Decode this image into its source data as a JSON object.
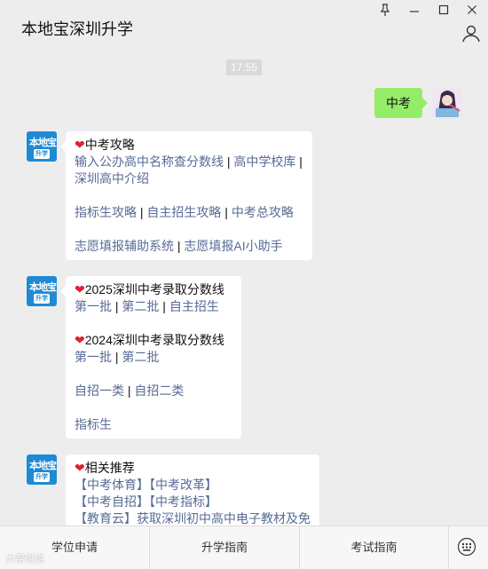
{
  "window": {
    "title": "本地宝深圳升学",
    "pin_icon": "pin-icon",
    "minimize_icon": "minimize-icon",
    "maximize_icon": "maximize-icon",
    "close_icon": "close-icon",
    "profile_icon": "person-icon"
  },
  "timestamp": "17:55",
  "user_message": "中考",
  "bot_messages": [
    {
      "title": "中考攻略",
      "rows": [
        [
          "输入公办高中名称查分数线",
          "高中学校库"
        ],
        [
          "深圳高中介绍"
        ],
        [],
        [
          "指标生攻略",
          "自主招生攻略",
          "中考总攻略"
        ],
        [],
        [
          "志愿填报辅助系统",
          "志愿填报AI小助手"
        ]
      ]
    },
    {
      "title": "2025深圳中考录取分数线",
      "links1": [
        "第一批",
        "第二批",
        "自主招生"
      ],
      "title2": "2024深圳中考录取分数线",
      "links2": [
        "第一批",
        "第二批"
      ],
      "links3": [
        "自招一类",
        "自招二类"
      ],
      "links4": [
        "指标生"
      ]
    },
    {
      "title": "相关推荐",
      "line1": [
        "【中考体育】",
        "【中考改革】"
      ],
      "line2": [
        "【中考自招】",
        "【中考指标】"
      ],
      "line3": "【教育云】获取深圳初中高中电子教材及免"
    }
  ],
  "bottom_tabs": [
    "学位申请",
    "升学指南",
    "考试指南"
  ],
  "keyboard_icon": "keyboard-icon",
  "watermark": "大帮说说"
}
